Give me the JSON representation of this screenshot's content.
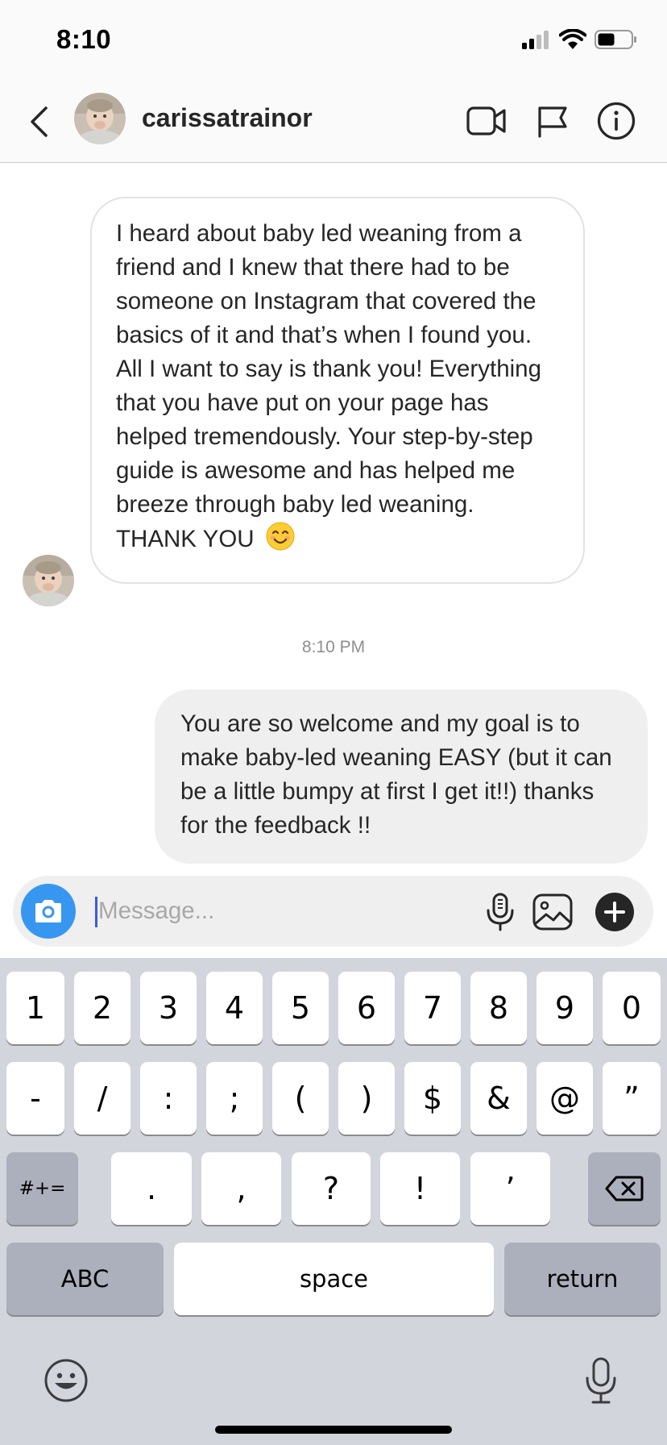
{
  "status_bar": {
    "time": "8:10"
  },
  "header": {
    "username": "carissatrainor"
  },
  "messages": [
    {
      "direction": "incoming",
      "text": "I heard about baby led weaning from a friend and I knew that there had to be someone on Instagram that covered the basics of it and that’s when I found you. All I want to say is thank you! Everything that you have put on your page has helped tremendously. Your step-by-step guide is awesome and has helped me breeze through baby led weaning. THANK YOU"
    },
    {
      "direction": "outgoing",
      "text": "You are so welcome and my goal is to make baby-led weaning EASY (but it can be a little bumpy at first I get it!!) thanks for the feedback !!"
    }
  ],
  "timestamp": "8:10 PM",
  "composer": {
    "placeholder": "Message..."
  },
  "keyboard": {
    "row1": [
      "1",
      "2",
      "3",
      "4",
      "5",
      "6",
      "7",
      "8",
      "9",
      "0"
    ],
    "row2": [
      "-",
      "/",
      ":",
      ";",
      "(",
      ")",
      "$",
      "&",
      "@",
      "”"
    ],
    "row3": [
      ".",
      ",",
      "?",
      "!",
      "’"
    ],
    "symbols_key": "#+=",
    "abc_key": "ABC",
    "space_key": "space",
    "return_key": "return"
  }
}
